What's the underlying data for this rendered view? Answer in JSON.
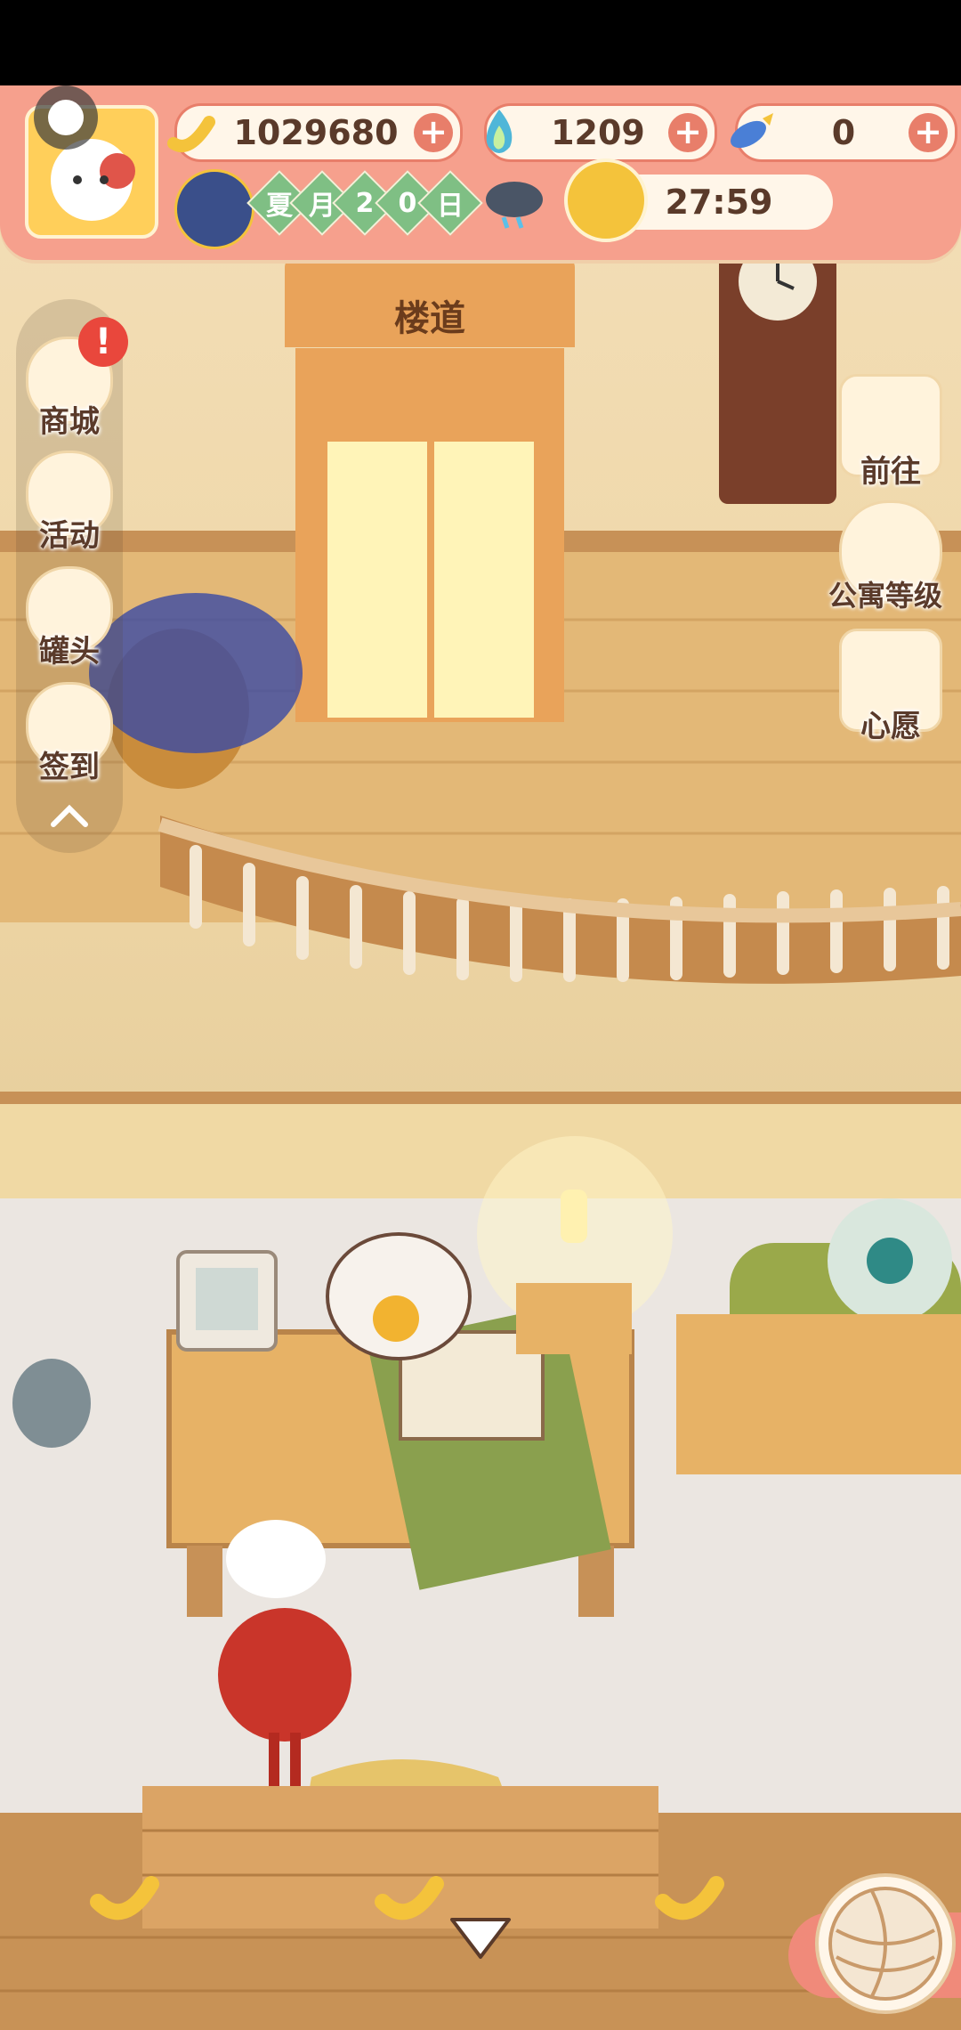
{
  "hud": {
    "bananas": "1029680",
    "flames": "1209",
    "fish": "0",
    "date": [
      "夏",
      "月",
      "2",
      "0",
      "日"
    ],
    "weather_icon": "rain-cloud-icon",
    "timer": "27:59"
  },
  "left_menu": {
    "items": [
      {
        "label": "商城",
        "icon": "shop-icon",
        "badge": "!"
      },
      {
        "label": "活动",
        "icon": "gift-icon"
      },
      {
        "label": "罐头",
        "icon": "can-icon"
      },
      {
        "label": "签到",
        "icon": "checkin-icon"
      }
    ],
    "collapse_icon": "chevron-up-icon"
  },
  "right_menu": {
    "items": [
      {
        "label": "前往",
        "icon": "map-pin-icon"
      },
      {
        "label": "公寓等级",
        "icon": "apartment-level-icon"
      },
      {
        "label": "心愿",
        "icon": "wish-book-icon"
      }
    ]
  },
  "scene": {
    "door_sign": "楼道"
  },
  "colors": {
    "hud_bg": "#f6a08d",
    "accent": "#e87e6a",
    "date_green": "#7fbf84"
  }
}
